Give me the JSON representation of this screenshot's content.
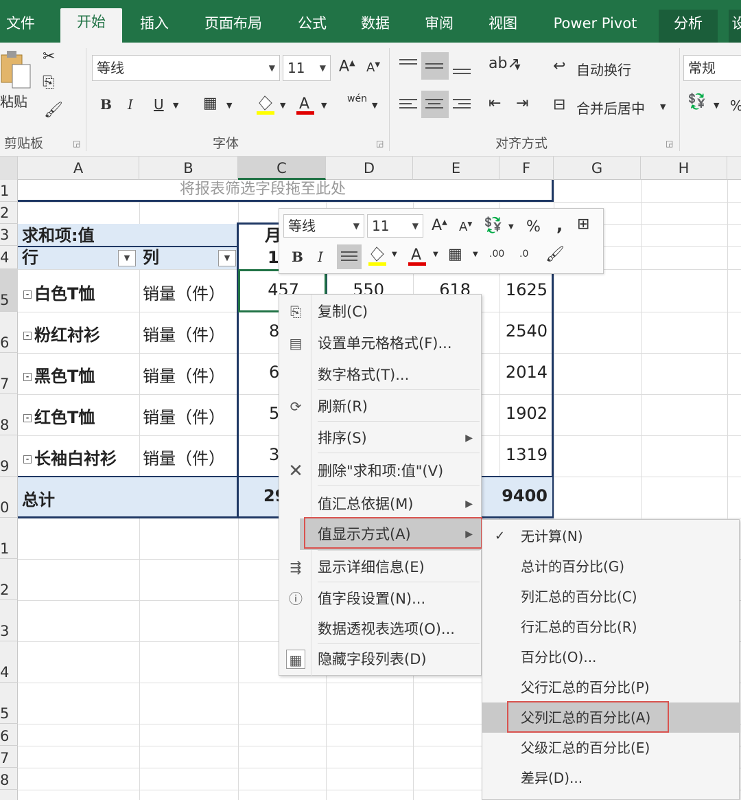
{
  "tabs": [
    "文件",
    "开始",
    "插入",
    "页面布局",
    "公式",
    "数据",
    "审阅",
    "视图",
    "Power Pivot",
    "分析",
    "设"
  ],
  "active_tab": "开始",
  "ribbon": {
    "paste_label": "粘贴",
    "clipboard_group": "剪贴板",
    "font_name": "等线",
    "font_size": "11",
    "font_group": "字体",
    "bold": "B",
    "italic": "I",
    "underline": "U",
    "wen": "wén",
    "wrap_text": "自动换行",
    "merge_center": "合并后居中",
    "align_group": "对齐方式",
    "number_format": "常规",
    "percent": "%"
  },
  "columns": [
    "A",
    "B",
    "C",
    "D",
    "E",
    "F",
    "G",
    "H"
  ],
  "rows": [
    "1",
    "2",
    "3",
    "4",
    "5",
    "6",
    "7",
    "8",
    "9",
    "0",
    "1",
    "2",
    "3",
    "4",
    "5",
    "6",
    "7",
    "8"
  ],
  "pivot": {
    "filter_drop_text": "将报表筛选字段拖至此处",
    "values_label": "求和项:值",
    "row_label": "行",
    "col_label": "列",
    "col_header_partial": "月",
    "col_header_sub": "1",
    "rows": [
      {
        "name": "白色T恤",
        "measure": "销量（件）",
        "c": "457",
        "d": "550",
        "e": "618",
        "f": "1625"
      },
      {
        "name": "粉红衬衫",
        "measure": "销量（件）",
        "c": "8",
        "d": "",
        "e": "",
        "f": "2540"
      },
      {
        "name": "黑色T恤",
        "measure": "销量（件）",
        "c": "6",
        "d": "",
        "e": "",
        "f": "2014"
      },
      {
        "name": "红色T恤",
        "measure": "销量（件）",
        "c": "5",
        "d": "",
        "e": "",
        "f": "1902"
      },
      {
        "name": "长袖白衬衫",
        "measure": "销量（件）",
        "c": "3",
        "d": "",
        "e": "",
        "f": "1319"
      }
    ],
    "total_label": "总计",
    "total_c": "29",
    "total_f": "9400"
  },
  "minibar": {
    "font_name": "等线",
    "font_size": "11",
    "percent": "%",
    "comma": ",",
    "bold": "B",
    "italic": "I",
    "inc_decimal": ".00",
    "dec_decimal": ".0"
  },
  "context_menu": {
    "items": [
      {
        "label": "复制(C)",
        "icon": "copy-icon"
      },
      {
        "label": "设置单元格格式(F)...",
        "icon": "format-cells-icon"
      },
      {
        "label": "数字格式(T)...",
        "icon": ""
      },
      {
        "label": "刷新(R)",
        "icon": "refresh-icon"
      },
      {
        "label": "排序(S)",
        "icon": ""
      },
      {
        "label": "删除\"求和项:值\"(V)",
        "icon": "delete-x-icon"
      },
      {
        "label": "值汇总依据(M)",
        "icon": ""
      },
      {
        "label": "值显示方式(A)",
        "icon": ""
      },
      {
        "label": "显示详细信息(E)",
        "icon": "show-detail-icon"
      },
      {
        "label": "值字段设置(N)...",
        "icon": "field-settings-icon"
      },
      {
        "label": "数据透视表选项(O)...",
        "icon": ""
      },
      {
        "label": "隐藏字段列表(D)",
        "icon": "field-list-icon"
      }
    ]
  },
  "submenu": {
    "items": [
      "无计算(N)",
      "总计的百分比(G)",
      "列汇总的百分比(C)",
      "行汇总的百分比(R)",
      "百分比(O)...",
      "父行汇总的百分比(P)",
      "父列汇总的百分比(A)",
      "父级汇总的百分比(E)",
      "差异(D)..."
    ],
    "checked_index": 0,
    "highlighted_index": 6
  },
  "colors": {
    "excel_green": "#217346",
    "pivot_blue": "#dde9f6",
    "pivot_border": "#1f3864",
    "highlight_red": "#d9534f"
  }
}
